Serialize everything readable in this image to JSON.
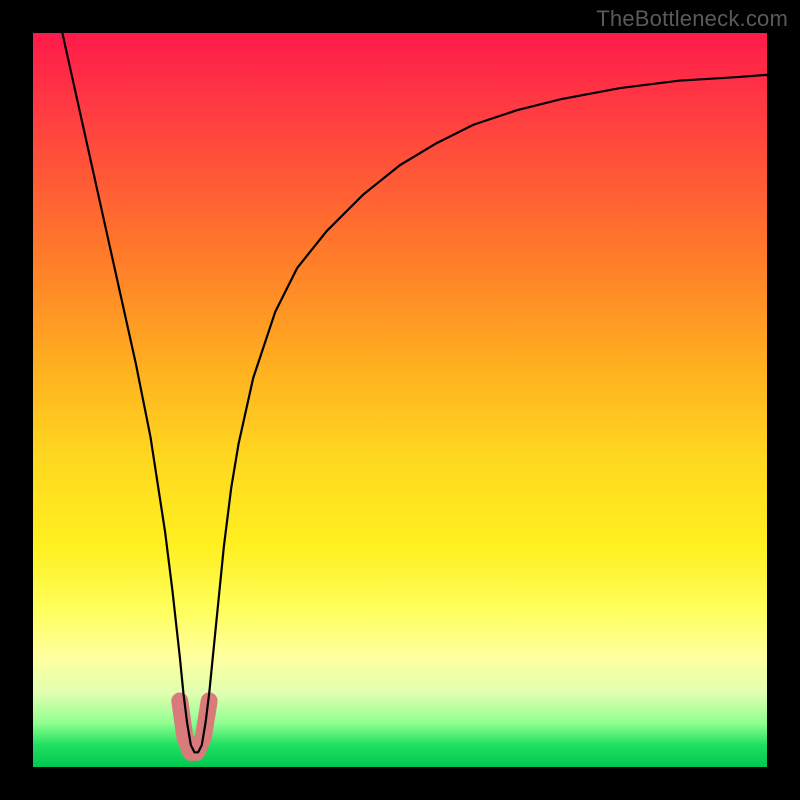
{
  "watermark": "TheBottleneck.com",
  "chart_data": {
    "type": "line",
    "title": "",
    "xlabel": "",
    "ylabel": "",
    "xlim": [
      0,
      100
    ],
    "ylim": [
      0,
      100
    ],
    "series": [
      {
        "name": "curve",
        "x": [
          4,
          6,
          8,
          10,
          12,
          14,
          16,
          18,
          19,
          20,
          20.5,
          21,
          21.5,
          22,
          22.5,
          23,
          23.5,
          24,
          25,
          26,
          27,
          28,
          30,
          33,
          36,
          40,
          45,
          50,
          55,
          60,
          66,
          72,
          80,
          88,
          96,
          100
        ],
        "y": [
          100,
          91,
          82,
          73,
          64,
          55,
          45,
          32,
          24,
          15,
          10,
          6,
          3,
          2,
          2,
          3,
          6,
          10,
          20,
          30,
          38,
          44,
          53,
          62,
          68,
          73,
          78,
          82,
          85,
          87.5,
          89.5,
          91,
          92.5,
          93.5,
          94,
          94.3
        ]
      }
    ],
    "marker_region": {
      "name": "highlight-bottom",
      "color": "#d97b7b",
      "points": [
        {
          "x": 20.0,
          "y": 9
        },
        {
          "x": 20.7,
          "y": 4
        },
        {
          "x": 21.5,
          "y": 2
        },
        {
          "x": 22.3,
          "y": 2
        },
        {
          "x": 23.2,
          "y": 4
        },
        {
          "x": 24.0,
          "y": 9
        }
      ]
    }
  }
}
